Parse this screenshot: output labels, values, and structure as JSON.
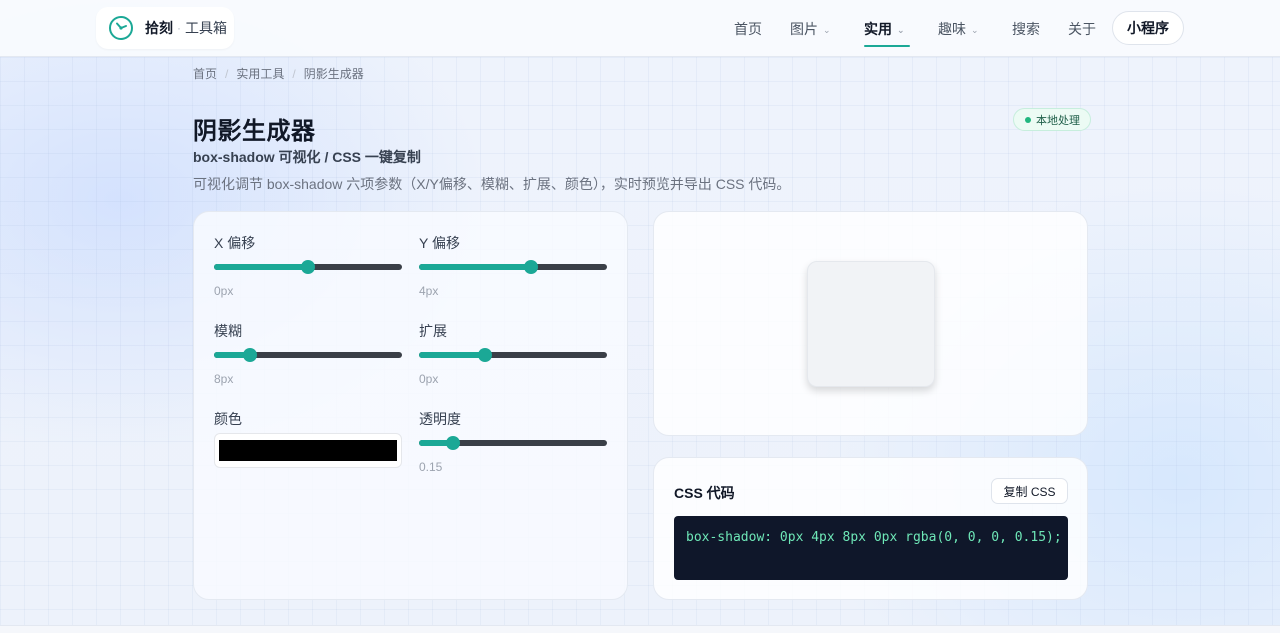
{
  "header": {
    "logo_name": "拾刻",
    "logo_dot": "·",
    "logo_sub": "工具箱",
    "nav": [
      {
        "label": "首页",
        "has_menu": false,
        "active": false
      },
      {
        "label": "图片",
        "has_menu": true,
        "active": false
      },
      {
        "label": "实用",
        "has_menu": true,
        "active": true
      },
      {
        "label": "趣味",
        "has_menu": true,
        "active": false
      },
      {
        "label": "搜索",
        "has_menu": false,
        "active": false
      },
      {
        "label": "关于",
        "has_menu": false,
        "active": false
      }
    ],
    "chevron": "⌄",
    "mini_program_label": "小程序",
    "accent_color": "#1ba896"
  },
  "breadcrumb": {
    "items": [
      "首页",
      "实用工具",
      "阴影生成器"
    ],
    "separator": "/"
  },
  "page": {
    "title": "阴影生成器",
    "subtitle": "box-shadow 可视化 / CSS 一键复制",
    "description": "可视化调节 box-shadow 六项参数（X/Y偏移、模糊、扩展、颜色），实时预览并导出 CSS 代码。",
    "badge": "本地处理"
  },
  "controls": {
    "x_offset": {
      "label": "X 偏移",
      "value_text": "0px",
      "fraction": 0.5
    },
    "y_offset": {
      "label": "Y 偏移",
      "value_text": "4px",
      "fraction": 0.595
    },
    "blur": {
      "label": "模糊",
      "value_text": "8px",
      "fraction": 0.19
    },
    "spread": {
      "label": "扩展",
      "value_text": "0px",
      "fraction": 0.35
    },
    "color": {
      "label": "颜色",
      "value": "#000000"
    },
    "opacity": {
      "label": "透明度",
      "value_text": "0.15",
      "fraction": 0.18
    }
  },
  "code": {
    "title": "CSS 代码",
    "copy_label": "复制 CSS",
    "css": "box-shadow: 0px 4px 8px 0px rgba(0, 0, 0, 0.15);"
  }
}
